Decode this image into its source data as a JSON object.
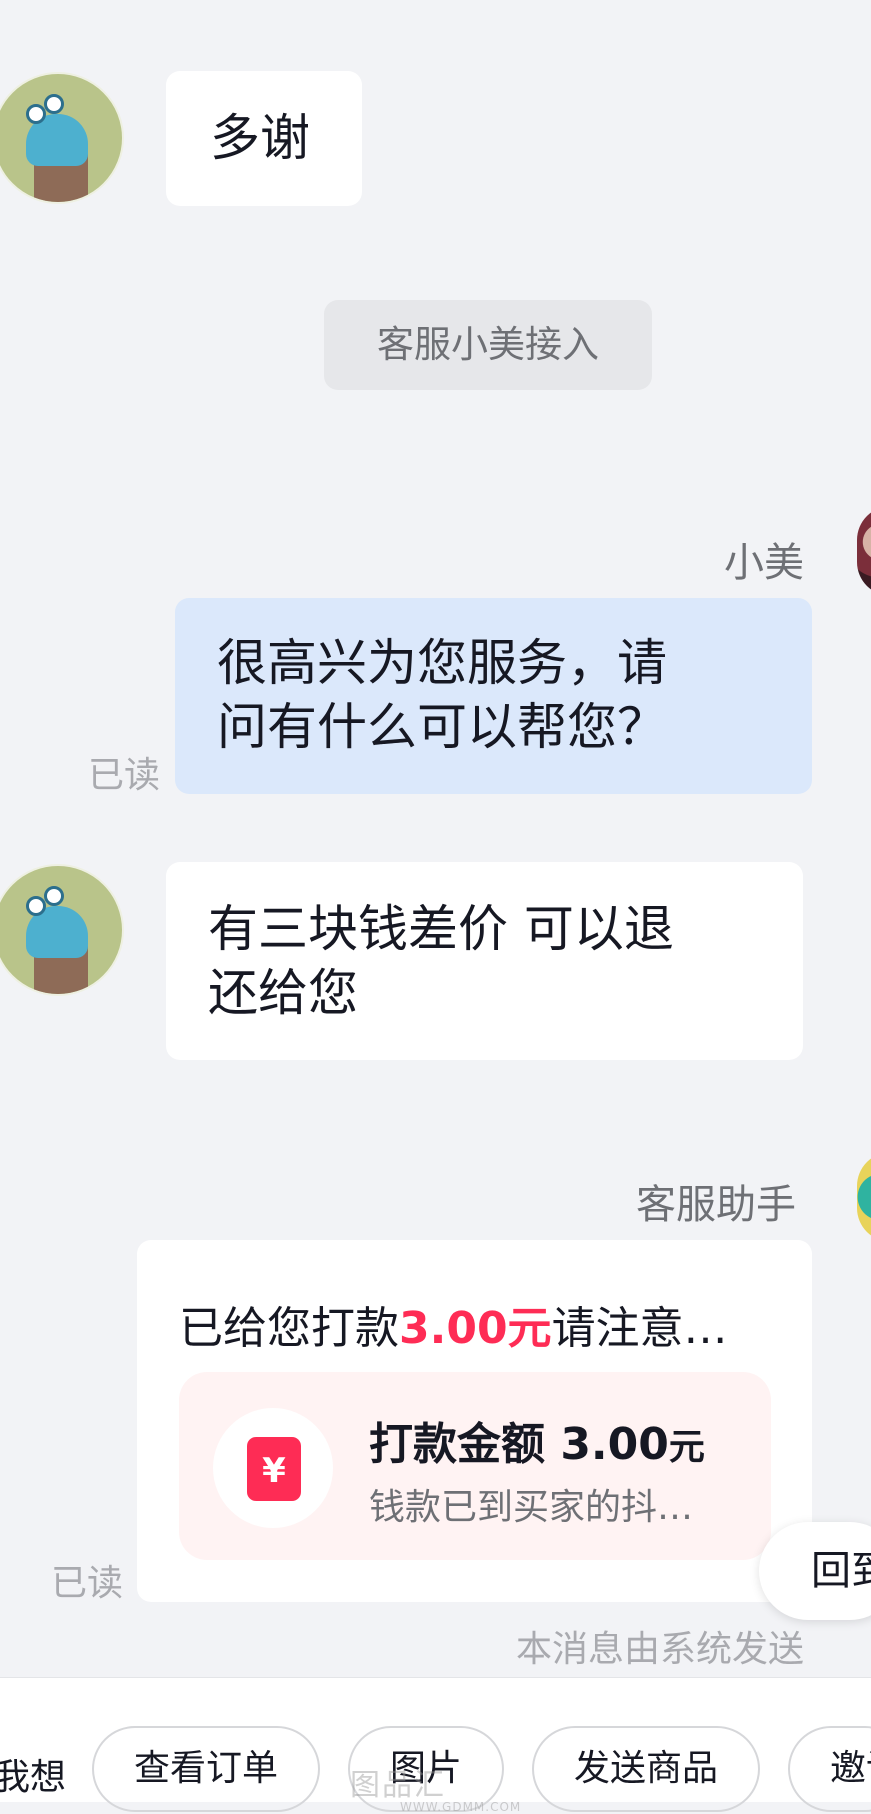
{
  "messages": {
    "m1_text": "多谢",
    "system_join": "客服小美接入",
    "m2_sender": "小美",
    "m2_text_line1": "很高兴为您服务，请",
    "m2_text_line2": "问有什么可以帮您？",
    "m2_read": "已读",
    "m3_text_line1": "有三块钱差价 可以退",
    "m3_text_line2": "还给您",
    "m4_sender": "客服助手",
    "card_title_prefix": "已给您打款",
    "card_title_amount": "3.00元",
    "card_title_suffix": "请注意…",
    "card_inner_title": "打款金额 3.00",
    "card_inner_unit": "元",
    "card_inner_sub": "钱款已到买家的抖…",
    "card_icon_glyph": "¥",
    "m4_read": "已读",
    "system_note": "本消息由系统发送"
  },
  "float_button": {
    "label": "回到"
  },
  "bottom_bar": {
    "lead_label": "我想",
    "chips": [
      "查看订单",
      "图片",
      "发送商品",
      "邀请"
    ]
  },
  "watermark": {
    "text": "图品汇",
    "sub": "WWW.GDMM.COM"
  },
  "colors": {
    "background": "#f2f3f6",
    "user_bubble": "#ffffff",
    "agent_bubble": "#dbe8fb",
    "accent": "#fe2c55"
  },
  "icons": {
    "user_avatar": "snail-avatar-icon",
    "agent_avatar": "agent-avatar-icon",
    "assistant_avatar": "assistant-avatar-icon",
    "card_icon": "red-envelope-yuan-icon"
  }
}
